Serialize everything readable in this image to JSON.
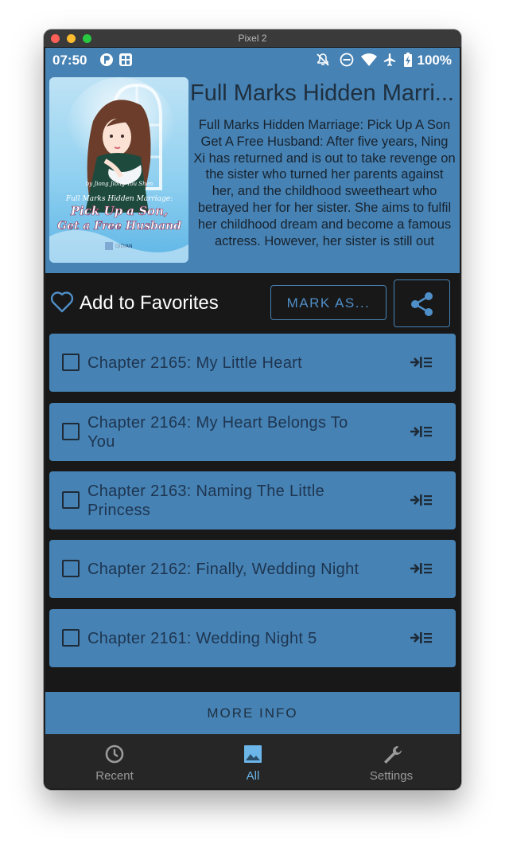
{
  "window": {
    "title": "Pixel 2"
  },
  "status_bar": {
    "time": "07:50",
    "battery": "100%"
  },
  "book": {
    "title": "Full Marks Hidden Marri...",
    "cover": {
      "author_line": "by Jiong Jiong You Shen",
      "title_small": "Full Marks Hidden Marriage:",
      "title_big_1": "Pick Up a Son,",
      "title_big_2": "Get a Free Husband",
      "publisher": "QIDIAN"
    },
    "description": "Full Marks Hidden Marriage: Pick Up A Son Get A Free Husband: After five years, Ning Xi has returned and is out to take revenge on the sister who turned her parents against her, and the childhood sweetheart who betrayed her for her sister. She aims to fulfil her childhood dream and become a famous actress. However, her sister is still out"
  },
  "actions": {
    "favorites_label": "Add to Favorites",
    "mark_as_label": "MARK AS..."
  },
  "chapters": [
    {
      "title": "Chapter 2165: My Little Heart"
    },
    {
      "title": "Chapter 2164: My Heart Belongs To You"
    },
    {
      "title": "Chapter 2163: Naming The Little Princess"
    },
    {
      "title": "Chapter 2162: Finally, Wedding Night"
    },
    {
      "title": "Chapter 2161: Wedding Night 5"
    }
  ],
  "more_info_label": "MORE INFO",
  "bottom_nav": {
    "recent": "Recent",
    "all": "All",
    "settings": "Settings",
    "active": "all"
  },
  "colors": {
    "accent": "#4682b4",
    "active_nav": "#6bb5e8",
    "inactive_nav": "#9a9a9a"
  },
  "icons": {
    "status": [
      "notifications-off-icon",
      "do-not-disturb-icon",
      "wifi-icon",
      "airplane-icon",
      "battery-charging-icon"
    ],
    "nav": [
      "clock-icon",
      "image-icon",
      "wrench-icon"
    ]
  }
}
